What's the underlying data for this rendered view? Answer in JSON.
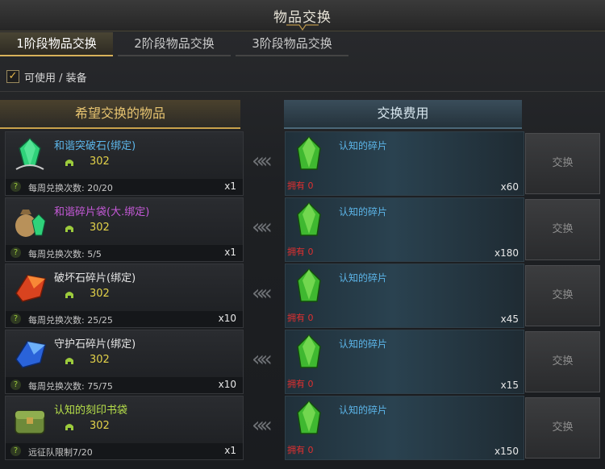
{
  "window": {
    "title": "物品交换"
  },
  "tabs": [
    {
      "label": "1阶段物品交换",
      "active": true
    },
    {
      "label": "2阶段物品交换",
      "active": false
    },
    {
      "label": "3阶段物品交换",
      "active": false
    }
  ],
  "filter": {
    "label": "可使用 / 装备",
    "checked": true,
    "check_glyph": "✓"
  },
  "headers": {
    "left": "希望交换的物品",
    "right": "交换费用"
  },
  "arrow_glyph": "«",
  "help_glyph": "?",
  "rows": [
    {
      "item_name": "和谐突破石(绑定)",
      "item_color": "#5cb6ea",
      "item_icon": "green-crystal-icon",
      "price": "302",
      "limit": "每周兑换次数: 20/20",
      "qty": "x1",
      "cost_name": "认知的碎片",
      "own": "拥有 0",
      "cost_qty": "x60",
      "button": "交换"
    },
    {
      "item_name": "和谐碎片袋(大.绑定)",
      "item_color": "#c65ad9",
      "item_icon": "sack-icon",
      "price": "302",
      "limit": "每周兑换次数: 5/5",
      "qty": "x1",
      "cost_name": "认知的碎片",
      "own": "拥有 0",
      "cost_qty": "x180",
      "button": "交换"
    },
    {
      "item_name": "破坏石碎片(绑定)",
      "item_color": "#e6e6e6",
      "item_icon": "red-shard-icon",
      "price": "302",
      "limit": "每周兑换次数: 25/25",
      "qty": "x10",
      "cost_name": "认知的碎片",
      "own": "拥有 0",
      "cost_qty": "x45",
      "button": "交换"
    },
    {
      "item_name": "守护石碎片(绑定)",
      "item_color": "#e6e6e6",
      "item_icon": "blue-shard-icon",
      "price": "302",
      "limit": "每周兑换次数: 75/75",
      "qty": "x10",
      "cost_name": "认知的碎片",
      "own": "拥有 0",
      "cost_qty": "x15",
      "button": "交换"
    },
    {
      "item_name": "认知的刻印书袋",
      "item_color": "#b7e04a",
      "item_icon": "green-bag-icon",
      "price": "302",
      "limit": "远征队限制7/20",
      "qty": "x1",
      "cost_name": "认知的碎片",
      "own": "拥有 0",
      "cost_qty": "x150",
      "button": "交换"
    }
  ]
}
